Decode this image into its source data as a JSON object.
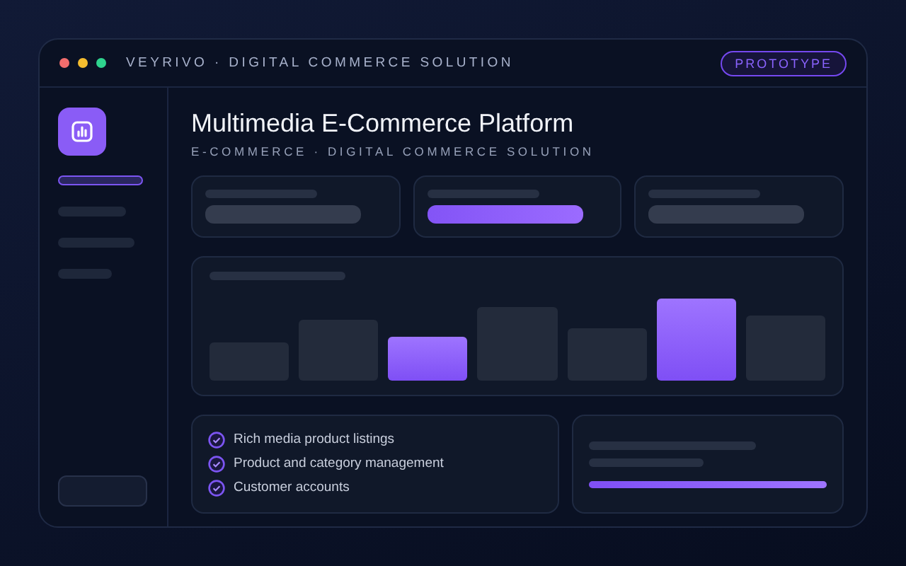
{
  "window": {
    "title": "VEYRIVO · DIGITAL COMMERCE SOLUTION",
    "badge": "PROTOTYPE"
  },
  "sidebar": {
    "items": [
      {
        "selected": true
      },
      {
        "selected": false
      },
      {
        "selected": false
      },
      {
        "selected": false
      }
    ]
  },
  "header": {
    "title": "Multimedia E-Commerce Platform",
    "subtitle": "E-COMMERCE · DIGITAL COMMERCE SOLUTION"
  },
  "stat_cards": [
    {
      "selected": false
    },
    {
      "selected": true
    },
    {
      "selected": false
    }
  ],
  "features": [
    {
      "label": "Rich media product listings",
      "checked": true
    },
    {
      "label": "Product and category management",
      "checked": true
    },
    {
      "label": "Customer accounts",
      "checked": true
    }
  ],
  "progress": {
    "level": 1
  }
}
